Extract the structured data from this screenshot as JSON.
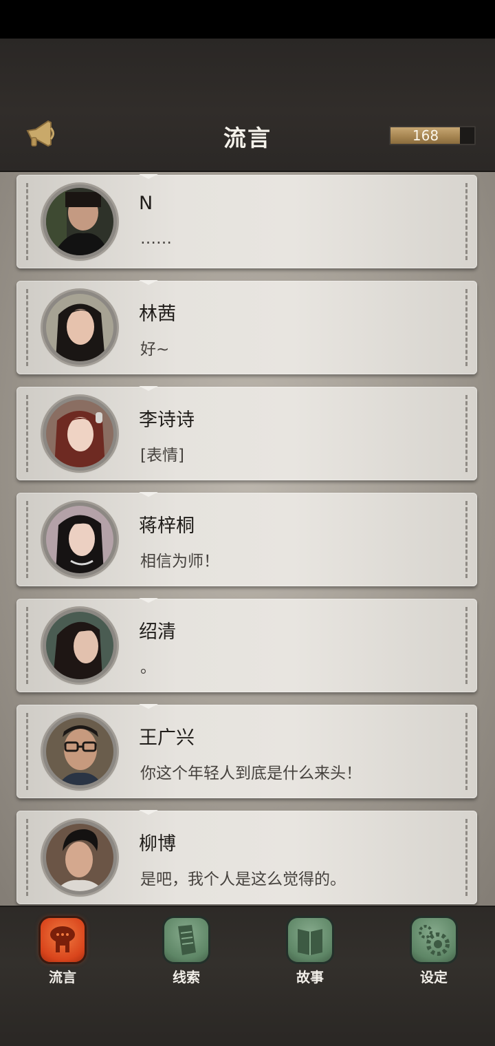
{
  "header": {
    "title": "流言",
    "coins": "168",
    "coin_fill_fraction": 0.83
  },
  "messages": [
    {
      "name": "N",
      "text": "……",
      "avatar": "avatar-man-shadow"
    },
    {
      "name": "林茜",
      "text": "好~",
      "avatar": "avatar-woman-long-hair"
    },
    {
      "name": "李诗诗",
      "text": "[表情]",
      "avatar": "avatar-woman-red-hair"
    },
    {
      "name": "蒋梓桐",
      "text": "相信为师！",
      "avatar": "avatar-woman-black-hair"
    },
    {
      "name": "绍清",
      "text": "。",
      "avatar": "avatar-woman-dark-hair"
    },
    {
      "name": "王广兴",
      "text": "你这个年轻人到底是什么来头！",
      "avatar": "avatar-man-glasses"
    },
    {
      "name": "柳博",
      "text": "是吧，我个人是这么觉得的。",
      "avatar": "avatar-man-pompadour"
    }
  ],
  "tabs": [
    {
      "label": "流言",
      "icon": "rumor-icon",
      "active": true
    },
    {
      "label": "线索",
      "icon": "clue-icon",
      "active": false
    },
    {
      "label": "故事",
      "icon": "story-icon",
      "active": false
    },
    {
      "label": "设定",
      "icon": "settings-icon",
      "active": false
    }
  ],
  "colors": {
    "active_tab": "#e0552a",
    "inactive_tab": "#5f8a6a",
    "coin_fill": "#b8975f"
  }
}
